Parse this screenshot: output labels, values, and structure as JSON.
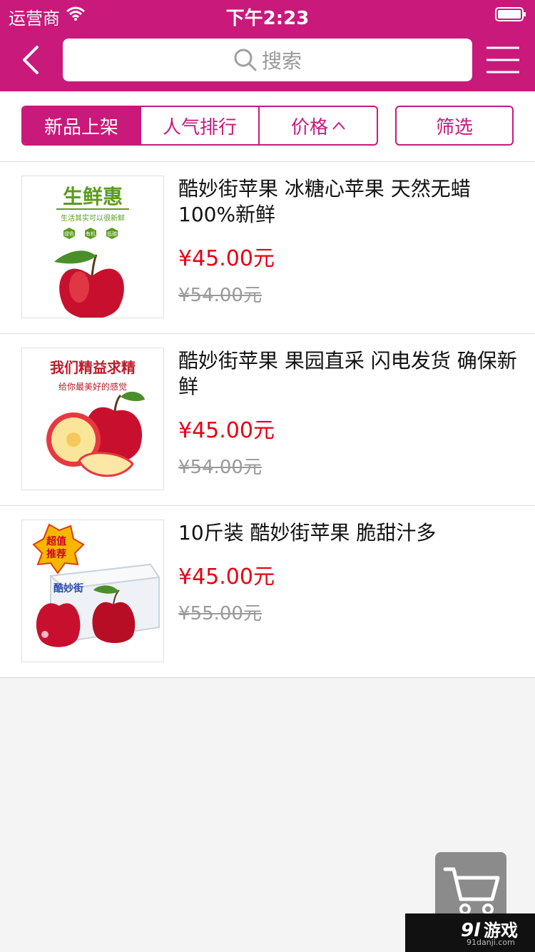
{
  "status_bar": {
    "carrier": "运营商",
    "time": "下午2:23"
  },
  "nav": {
    "search_placeholder": "搜索"
  },
  "filters": {
    "tabs": [
      {
        "label": "新品上架",
        "active": true
      },
      {
        "label": "人气排行",
        "active": false
      },
      {
        "label": "价格",
        "active": false,
        "icon": "chevron-up-icon"
      }
    ],
    "filter_label": "筛选"
  },
  "products": [
    {
      "title": "酷妙街苹果 冰糖心苹果 天然无蜡100%新鲜",
      "price": "¥45.00元",
      "old_price": "¥54.00元",
      "image": {
        "headline": "生鲜惠",
        "subline": "生活其实可以很新鲜",
        "tags": [
          "绿色",
          "有机",
          "低碳"
        ]
      }
    },
    {
      "title": "酷妙街苹果 果园直采 闪电发货 确保新鲜",
      "price": "¥45.00元",
      "old_price": "¥54.00元",
      "image": {
        "headline": "我们精益求精",
        "subline": "给你最美好的感觉"
      }
    },
    {
      "title": "10斤装  酷妙街苹果  脆甜汁多",
      "price": "¥45.00元",
      "old_price": "¥55.00元",
      "image": {
        "badge_line1": "超值",
        "badge_line2": "推荐",
        "brand": "酷妙街"
      }
    }
  ],
  "watermark": {
    "brand": "游戏",
    "url": "91danji.com"
  },
  "colors": {
    "brand": "#c9197a",
    "price": "#e60012"
  }
}
